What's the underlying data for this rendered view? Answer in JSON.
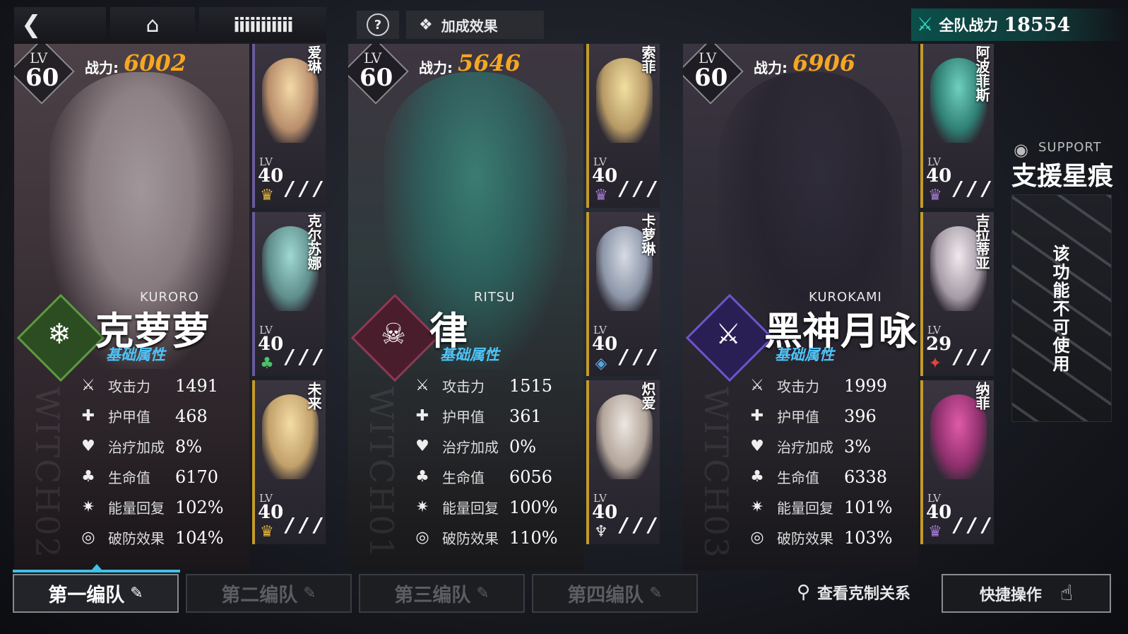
{
  "topbar": {
    "back_icon": "back-arrow-icon",
    "home_icon": "home-icon",
    "dots_text": "iiiiiiiiiii",
    "help_icon": "?",
    "bonus_label": "加成效果",
    "team_power_label": "全队战力",
    "team_power_value": "18554"
  },
  "stat_labels": [
    "攻击力",
    "护甲值",
    "治疗加成",
    "生命值",
    "能量回复",
    "破防效果"
  ],
  "stat_icons": [
    "⚔",
    "✚",
    "♥",
    "♣",
    "✷",
    "◎"
  ],
  "cards": [
    {
      "lv_label": "LV",
      "lv": "60",
      "power_label": "战力:",
      "power": "6002",
      "roma": "KURORO",
      "name": "克萝萝",
      "basic": "基础属性",
      "witch": "WITCH02",
      "stats": [
        "1491",
        "468",
        "8%",
        "6170",
        "102%",
        "104%"
      ],
      "subs": [
        {
          "name": "爱琳",
          "lv": "40",
          "icon": "♛",
          "slash": "/ / /"
        },
        {
          "name": "克尔苏娜",
          "lv": "40",
          "icon": "♣",
          "slash": "/ / /"
        },
        {
          "name": "未来",
          "lv": "40",
          "icon": "♛",
          "slash": "/ / /"
        }
      ]
    },
    {
      "lv_label": "LV",
      "lv": "60",
      "power_label": "战力:",
      "power": "5646",
      "roma": "RITSU",
      "name": "律",
      "basic": "基础属性",
      "witch": "WITCH01",
      "stats": [
        "1515",
        "361",
        "0%",
        "6056",
        "100%",
        "110%"
      ],
      "subs": [
        {
          "name": "索菲",
          "lv": "40",
          "icon": "♛",
          "slash": "/ / /"
        },
        {
          "name": "卡萝琳",
          "lv": "40",
          "icon": "◈",
          "slash": "/ / /"
        },
        {
          "name": "炽爱",
          "lv": "40",
          "icon": "♆",
          "slash": "/ / /"
        }
      ]
    },
    {
      "lv_label": "LV",
      "lv": "60",
      "power_label": "战力:",
      "power": "6906",
      "roma": "KUROKAMI",
      "name": "黑神月咏",
      "basic": "基础属性",
      "witch": "WITCH03",
      "stats": [
        "1999",
        "396",
        "3%",
        "6338",
        "101%",
        "103%"
      ],
      "subs": [
        {
          "name": "阿波菲斯",
          "lv": "40",
          "icon": "♛",
          "slash": "/ / /"
        },
        {
          "name": "吉拉蒂亚",
          "lv": "29",
          "icon": "✦",
          "slash": "/ / /"
        },
        {
          "name": "纳菲",
          "lv": "40",
          "icon": "♛",
          "slash": "/ / /"
        }
      ]
    }
  ],
  "support": {
    "label_en": "SUPPORT",
    "label_cn": "支援星痕",
    "locked_text": "该功能不可使用"
  },
  "tabs": [
    {
      "label": "第一编队",
      "active": true
    },
    {
      "label": "第二编队",
      "active": false
    },
    {
      "label": "第三编队",
      "active": false
    },
    {
      "label": "第四编队",
      "active": false
    }
  ],
  "bottom": {
    "check_relation": "查看克制关系",
    "quick_ops": "快捷操作"
  },
  "colors": {
    "accent_blue": "#3fc1e8",
    "power_orange": "#f5a623",
    "team_teal": "#0b4f4a"
  }
}
